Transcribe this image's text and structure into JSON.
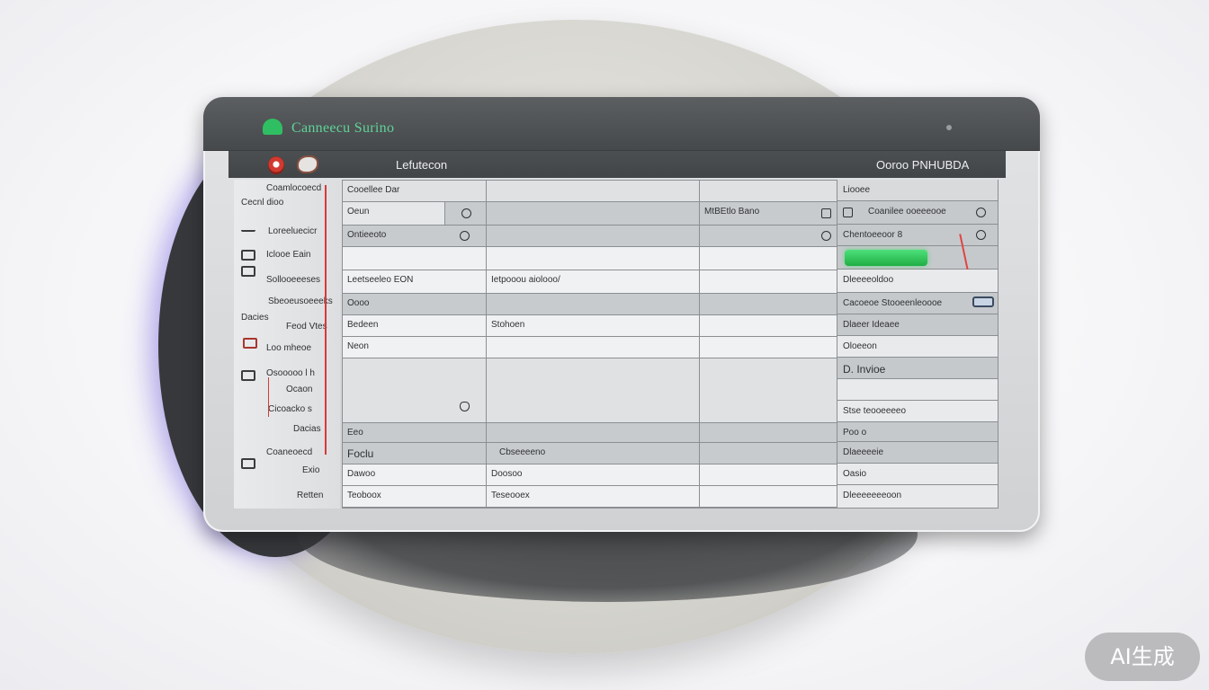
{
  "app": {
    "title": "Canneecu Surino",
    "brand_color": "#2fbf62"
  },
  "toolbar": {
    "title": "Lefutecon",
    "right_label": "Ooroo PNHUBDA"
  },
  "sidebar": {
    "items": [
      {
        "label": "Coamlocoecd",
        "icon": "none"
      },
      {
        "label": "Cecnl dioo",
        "icon": "none"
      },
      {
        "label": "Loreeluecicr",
        "icon": "list-icon"
      },
      {
        "label": "Iclooe Eain",
        "icon": "grid-icon"
      },
      {
        "label": "Sollooeeeses",
        "icon": "grid-icon"
      },
      {
        "label": "Sbeoeusoeeeks",
        "icon": "none"
      },
      {
        "label": "Dacies",
        "icon": "none"
      },
      {
        "label": "Feod Vtes",
        "icon": "none"
      },
      {
        "label": "Loo mheoe",
        "icon": "badge-icon"
      },
      {
        "label": "Osooooo l h",
        "icon": "grid-icon"
      },
      {
        "label": "Ocaon",
        "icon": "none"
      },
      {
        "label": "Cicoacko s",
        "icon": "none"
      },
      {
        "label": "Dacias",
        "icon": "none"
      },
      {
        "label": "Coaneoecd",
        "icon": "table-icon"
      },
      {
        "label": "Exio",
        "icon": "none"
      },
      {
        "label": "Retten",
        "icon": "none"
      }
    ]
  },
  "grid": {
    "header": [
      "Cooellee Dar",
      "",
      "",
      ""
    ],
    "rows": [
      [
        "Oeun",
        "",
        "MtBEtlo Bano",
        ""
      ],
      [
        "Ontieeoto",
        "",
        "",
        ""
      ],
      [
        "",
        "",
        "",
        ""
      ],
      [
        "Leetseeleo EON",
        "Ietpooou  aiolooo/",
        "",
        ""
      ],
      [
        "Oooo",
        "",
        "",
        ""
      ],
      [
        "Bedeen",
        "Stohoen",
        "",
        ""
      ],
      [
        "Neon",
        "",
        "",
        ""
      ],
      [
        "",
        "",
        "",
        ""
      ],
      [
        "Eeo",
        "",
        "",
        ""
      ],
      [
        "Foclu",
        "Cbseeeeno",
        "",
        ""
      ],
      [
        "Dawoo",
        "Doosoo",
        "",
        ""
      ],
      [
        "Teoboox",
        "Teseooex",
        "",
        ""
      ]
    ]
  },
  "rpanel": {
    "header": "Liooee",
    "rows": [
      "Coanilee ooeeeooe",
      "Chentoeeoor 8",
      "",
      "Dleeeeoldoo",
      "Cacoeoe Stooeenleoooe",
      "Dlaeer Ideaee",
      "Oloeeon",
      "D. Invioe",
      "",
      "Stse teooeeeeo",
      "Poo  o",
      "Dlaeeeeie",
      "Oasio",
      "Dleeeeeeeoon"
    ]
  },
  "watermark": "AI生成"
}
